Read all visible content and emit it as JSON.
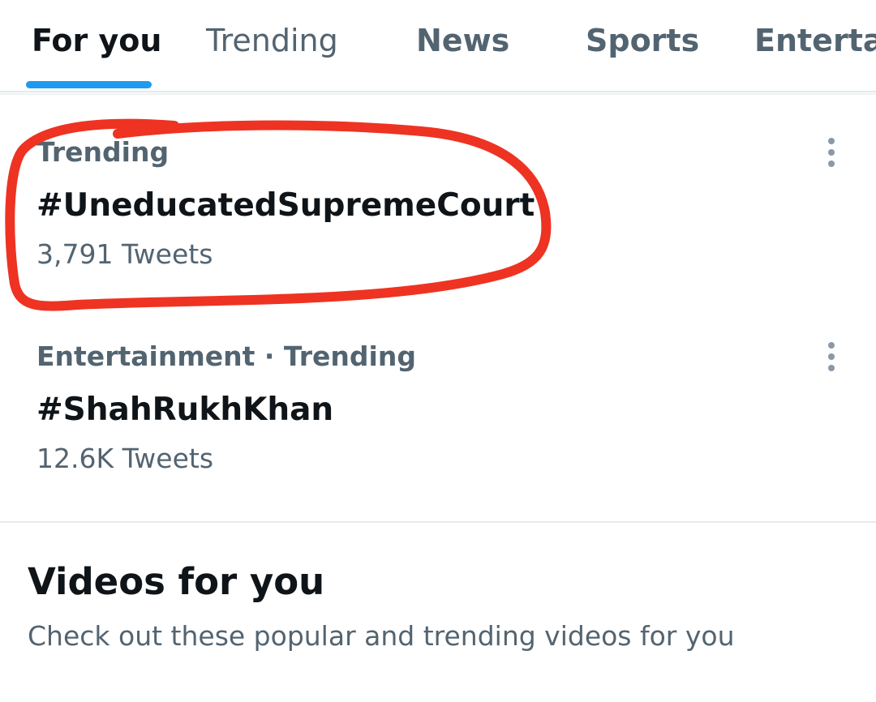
{
  "tabs": [
    {
      "label": "For you",
      "active": true
    },
    {
      "label": "Trending",
      "active": false
    },
    {
      "label": "News",
      "active": false
    },
    {
      "label": "Sports",
      "active": false
    },
    {
      "label": "Entertai",
      "active": false
    }
  ],
  "trends": [
    {
      "context": "Trending",
      "topic": "#UneducatedSupremeCourt",
      "count": "3,791 Tweets",
      "more_icon": "more-vertical-icon"
    },
    {
      "context": "Entertainment · Trending",
      "topic": "#ShahRukhKhan",
      "count": "12.6K Tweets",
      "more_icon": "more-vertical-icon"
    }
  ],
  "videos_section": {
    "title": "Videos for you",
    "subtitle": "Check out these popular and trending videos for you"
  },
  "colors": {
    "accent": "#1d9bf0",
    "text_primary": "#0f1419",
    "text_secondary": "#536471",
    "annotation_red": "#ee3322"
  }
}
